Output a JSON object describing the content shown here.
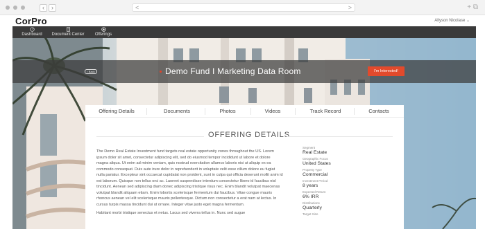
{
  "browser": {
    "address_left": "<",
    "address_right": ">",
    "corner": "+ ⧉"
  },
  "brand": "CorPro",
  "user_name": "Allyson Nicolase ⌄",
  "nav": [
    {
      "label": "Dashboard",
      "icon": "dashboard-icon"
    },
    {
      "label": "Document Center",
      "icon": "document-icon"
    },
    {
      "label": "Offerings",
      "icon": "offerings-icon"
    }
  ],
  "hero": {
    "back_label": "‹ Back",
    "title": "Demo Fund I Marketing Data Room",
    "cta_label": "I'm Interested!"
  },
  "tabs": [
    "Offering Details",
    "Documents",
    "Photos",
    "Videos",
    "Track Record",
    "Contacts"
  ],
  "section_title": "OFFERING DETAILS",
  "description": [
    "The Demo Real Estate Investment fund targets real estate opportunity zones throughout the US. Lorem ipsum dolor sit amet, consectetur adipiscing elit, sed do eiusmod tempor incididunt ut labore et dolore magna aliqua. Ut enim ad minim veniam, quis nostrud exercitation ullamco laboris nisi ut aliquip ex ea commodo consequat. Duis aute irure dolor in reprehenderit in voluptate velit esse cillum dolore eu fugiat nulla pariatur. Excepteur sint occaecat cupidatat non proident, sunt in culpa qui officia deserunt mollit anim id est laborum. Quisque non tellus orci ac. Laoreet suspendisse interdum consectetur libero id faucibus nisl tincidunt. Aenean sed adipiscing diam donec adipiscing tristique risus nec. Enim blandit volutpat maecenas volutpat blandit aliquam etiam. Enim lobortis scelerisque fermentum dui faucibus. Vitae congue mauris rhoncus aenean vel elit scelerisque mauris pellentesque. Dictum non consectetur a erat nam at lectus. In cursus turpis massa tincidunt dui ut ornare. Integer vitae justo eget magna fermentum.",
    "Habitant morbi tristique senectus et netus. Lacus sed viverra tellus in. Nunc sed augue"
  ],
  "facts": [
    {
      "key": "Segment",
      "value": "Real Estate"
    },
    {
      "key": "Geographic Focus",
      "value": "United States"
    },
    {
      "key": "Property Type",
      "value": "Commercial"
    },
    {
      "key": "Investment Period",
      "value": "8 years"
    },
    {
      "key": "Expected Return",
      "value": "6% IRR"
    },
    {
      "key": "Distributions",
      "value": "Quarterly"
    },
    {
      "key": "Target Size",
      "value": ""
    }
  ],
  "colors": {
    "accent": "#e24a2c",
    "nav_bg": "#3a3a3a"
  }
}
